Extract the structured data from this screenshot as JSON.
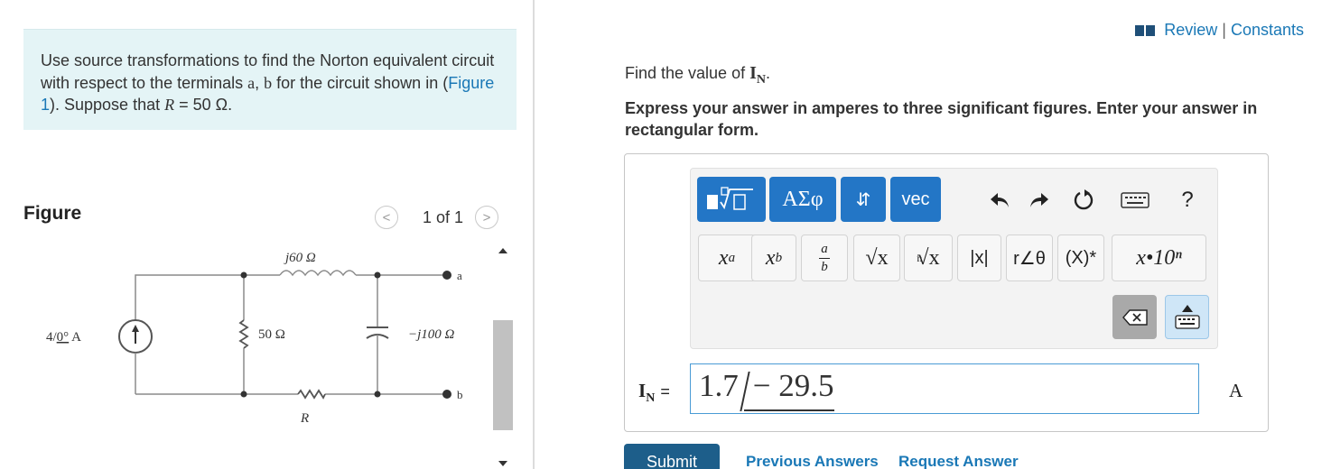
{
  "problem": {
    "intro": "Use source transformations to find the Norton equivalent circuit with respect to the terminals ",
    "terminal_a": "a",
    "comma": ", ",
    "terminal_b": "b",
    "middle": " for the circuit shown in (",
    "figure_link": "Figure 1",
    "after_link": "). Suppose that ",
    "r_var": "R",
    "r_value": " = 50 Ω."
  },
  "figure": {
    "label": "Figure",
    "pager": "1 of 1",
    "circuit": {
      "source_label": "4/0° A",
      "source_mag": "4/",
      "source_angle": "0°",
      "source_unit": " A",
      "inductor": "j60 Ω",
      "r50": "50 Ω",
      "capacitor": "−j100 Ω",
      "resistor": "R",
      "terminal_a": "a",
      "terminal_b": "b"
    }
  },
  "header": {
    "review": "Review",
    "separator": "|",
    "constants": "Constants"
  },
  "question": {
    "prefix": "Find the value of ",
    "var": "I",
    "sub": "N",
    "suffix": "."
  },
  "instructions": "Express your answer in amperes to three significant figures. Enter your answer in rectangular form.",
  "toolbar": {
    "greek": "ΑΣφ",
    "arrows": "⇵",
    "vec": "vec",
    "help": "?"
  },
  "symbols": {
    "power_base": "x",
    "power_exp": "a",
    "sub_base": "x",
    "sub_idx": "b",
    "frac_num": "a",
    "frac_den": "b",
    "sqrt": "√x",
    "nroot_n": "n",
    "nroot": "√x",
    "abs": "|x|",
    "polar": "r∠θ",
    "conj": "(X)*",
    "sci": "x•10ⁿ"
  },
  "answer": {
    "label_var": "I",
    "label_sub": "N",
    "label_eq": "=",
    "magnitude": "1.7",
    "angle": "− 29.5",
    "unit": "A"
  },
  "actions": {
    "submit": "Submit",
    "previous": "Previous Answers",
    "request": "Request Answer"
  },
  "colors": {
    "link": "#1a78b6",
    "toolbar_blue": "#2376c6",
    "submit": "#1d5e8a",
    "problem_bg": "#e4f4f6"
  }
}
